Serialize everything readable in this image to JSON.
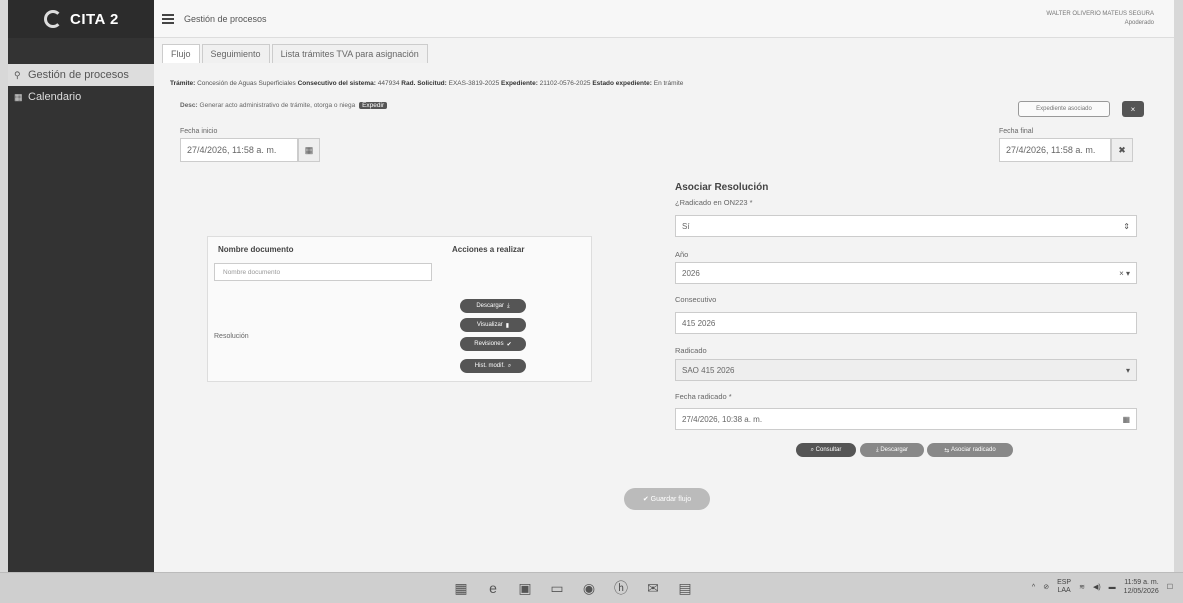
{
  "app": {
    "name": "CITA 2"
  },
  "sidebar": {
    "items": [
      {
        "label": "Gestión de procesos",
        "icon": "sitemap-icon"
      },
      {
        "label": "Calendario",
        "icon": "calendar-icon"
      }
    ]
  },
  "header": {
    "title": "Gestión de procesos",
    "user_name": "WALTER OLIVERIO MATEUS SEGURA",
    "user_sub": "Apoderado"
  },
  "tabs": [
    {
      "label": "Flujo"
    },
    {
      "label": "Seguimiento"
    },
    {
      "label": "Lista trámites TVA para asignación"
    }
  ],
  "info": {
    "tramite_label": "Trámite:",
    "tramite_value": "Concesión de Aguas Superficiales",
    "consecutivo_label": "Consecutivo del sistema:",
    "consecutivo_value": "447934",
    "sol_label": "Rad. Solicitud:",
    "sol_value": "EXAS-3819-2025",
    "exp_label": "Expediente:",
    "exp_value": "21102-0576-2025",
    "estado_label": "Estado expediente:",
    "estado_value": "En trámite"
  },
  "desc": {
    "label": "Desc:",
    "text": "Generar acto administrativo de trámite, otorga o niega",
    "tag": "Expedir"
  },
  "buttons": {
    "related": "Expediente asociado",
    "close": "×"
  },
  "fecha_inicio": {
    "label": "Fecha inicio",
    "value": "27/4/2026, 11:58 a. m."
  },
  "fecha_final": {
    "label": "Fecha final",
    "value": "27/4/2026, 11:58 a. m."
  },
  "documents": {
    "col_name": "Nombre documento",
    "col_actions": "Acciones a realizar",
    "placeholder": "Nombre documento",
    "row_label": "Resolución",
    "actions": [
      "Descargar",
      "Visualizar",
      "Revisiones",
      "Hist. modif."
    ]
  },
  "form": {
    "title": "Asociar Resolución",
    "q_label": "¿Radicado en ON223 *",
    "q_value": "Sí",
    "anio_label": "Año",
    "anio_value": "2026",
    "consec_label": "Consecutivo",
    "consec_value": "415 2026",
    "radicado_label": "Radicado",
    "radicado_value": "SAO 415 2026",
    "fecha_label": "Fecha radicado *",
    "fecha_value": "27/4/2026, 10:38 a. m.",
    "btn_consultar": "Consultar",
    "btn_descargar": "Descargar",
    "btn_asociar": "Asociar radicado"
  },
  "save": {
    "label": "Guardar flujo"
  },
  "taskbar": {
    "lang": "ESP",
    "lang2": "LAA",
    "time": "11:59 a. m.",
    "date": "12/05/2026"
  }
}
